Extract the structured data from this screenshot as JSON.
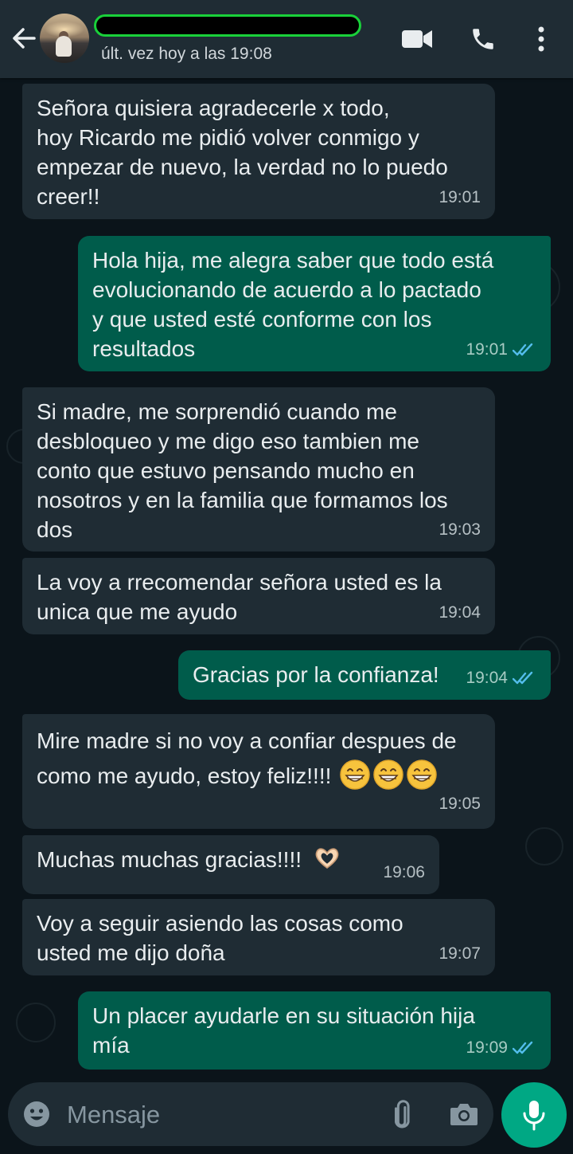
{
  "header": {
    "last_seen": "últ. vez hoy a las 19:08",
    "icons": [
      "back-arrow-icon",
      "video-call-icon",
      "phone-icon",
      "more-options-icon"
    ]
  },
  "messages": [
    {
      "direction": "incoming",
      "text": "Señora quisiera agradecerle x todo,\nhoy Ricardo me pidió volver conmigo y\nempezar de nuevo, la verdad no lo puedo\ncreer!!",
      "time": "19:01"
    },
    {
      "direction": "outgoing",
      "text": "Hola hija, me alegra saber que todo está\nevolucionando de acuerdo a lo pactado\ny que usted esté conforme con los\nresultados",
      "time": "19:01",
      "status": "read"
    },
    {
      "direction": "incoming",
      "text": "Si madre, me sorprendió cuando me\ndesbloqueo y me digo eso tambien me\nconto que estuvo pensando mucho en\nnosotros y en la familia que formamos los\ndos",
      "time": "19:03"
    },
    {
      "direction": "incoming",
      "text": "La voy a rrecomendar señora usted es la\nunica que me ayudo",
      "time": "19:04"
    },
    {
      "direction": "outgoing",
      "text": "Gracias por la confianza!",
      "time": "19:04",
      "status": "read"
    },
    {
      "direction": "incoming",
      "text": "Mire madre si no voy a confiar despues de\ncomo me ayudo, estoy feliz!!!!",
      "emoji": "😁😁😁",
      "time": "19:05"
    },
    {
      "direction": "incoming",
      "text": "Muchas muchas gracias!!!!",
      "emoji": "🫶",
      "time": "19:06"
    },
    {
      "direction": "incoming",
      "text": "Voy a seguir asiendo las cosas como\nusted me dijo doña",
      "time": "19:07"
    },
    {
      "direction": "outgoing",
      "text": "Un placer ayudarle en su situación hija\nmía",
      "time": "19:09",
      "status": "read"
    }
  ],
  "composer": {
    "placeholder": "Mensaje",
    "icons": [
      "emoji-icon",
      "attach-icon",
      "camera-icon",
      "microphone-icon"
    ]
  },
  "colors": {
    "background": "#0b141a",
    "header": "#1f2c34",
    "incoming_bubble": "#1f2c34",
    "outgoing_bubble": "#005c4b",
    "accent": "#00a884",
    "read_ticks": "#53bdeb"
  }
}
